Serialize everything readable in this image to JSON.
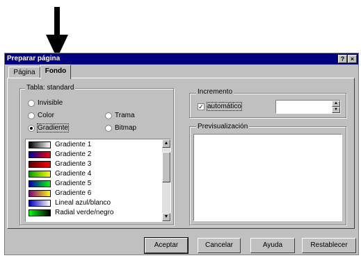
{
  "dialog": {
    "title": "Preparar página"
  },
  "tabs": [
    {
      "label": "Página"
    },
    {
      "label": "Fondo"
    }
  ],
  "left": {
    "table_label": "Tabla: standard",
    "options": [
      {
        "label": "Invisible",
        "selected": false
      },
      {
        "label": "Color",
        "selected": false
      },
      {
        "label": "Gradiente",
        "selected": true
      },
      {
        "label": "Trama",
        "selected": false
      },
      {
        "label": "Bitmap",
        "selected": false
      }
    ],
    "gradient_list": [
      {
        "label": "Gradiente 1",
        "swatch": [
          "#000000",
          "#ffffff"
        ]
      },
      {
        "label": "Gradiente 2",
        "swatch": [
          "#0000a0",
          "#ff0000"
        ]
      },
      {
        "label": "Gradiente 3",
        "swatch": [
          "#600000",
          "#ff0000"
        ]
      },
      {
        "label": "Gradiente 4",
        "swatch": [
          "#00a000",
          "#ffff00"
        ]
      },
      {
        "label": "Gradiente 5",
        "swatch": [
          "#0000c0",
          "#00ff00"
        ]
      },
      {
        "label": "Gradiente 6",
        "swatch": [
          "#800080",
          "#ffff00"
        ]
      },
      {
        "label": "Lineal azul/blanco",
        "swatch": [
          "#0000c0",
          "#ffffff"
        ]
      },
      {
        "label": "Radial verde/negro",
        "swatch": [
          "#00ff00",
          "#000000"
        ]
      }
    ]
  },
  "right": {
    "increment_label": "Incremento",
    "auto_label": "automático",
    "auto_checked": true,
    "preview_label": "Previsualización"
  },
  "buttons": {
    "ok": "Aceptar",
    "cancel": "Cancelar",
    "help": "Ayuda",
    "reset": "Restablecer"
  }
}
